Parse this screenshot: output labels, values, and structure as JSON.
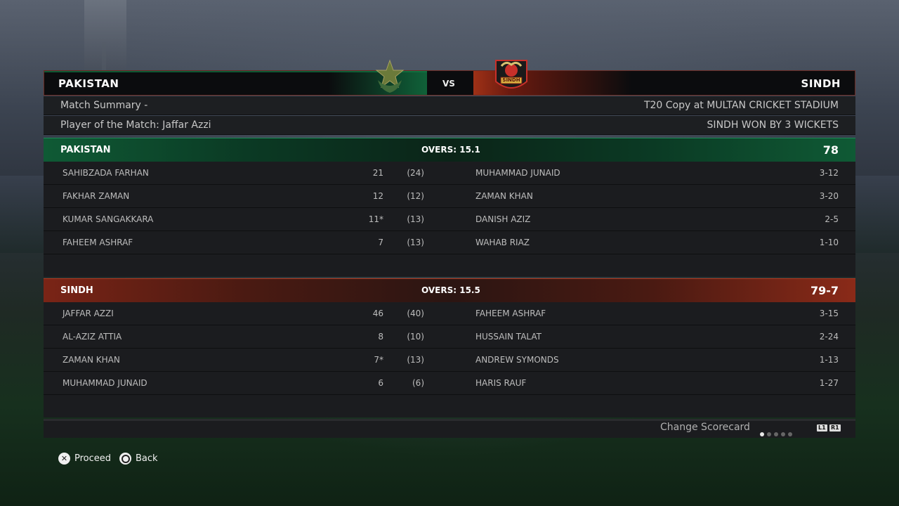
{
  "match": {
    "team_a": "PAKISTAN",
    "team_b": "SINDH",
    "vs": "VS",
    "summary_label": "Match Summary  -",
    "venue": "T20 Copy at MULTAN CRICKET STADIUM",
    "player_of_match": "Player of the Match: Jaffar Azzi",
    "result": "SINDH WON BY 3 WICKETS",
    "logo_b_text": "SINDH"
  },
  "innings": [
    {
      "team": "PAKISTAN",
      "overs": "OVERS: 15.1",
      "score": "78",
      "rows": [
        {
          "batter": "SAHIBZADA FARHAN",
          "runs": "21",
          "balls": "(24)",
          "bowler": "MUHAMMAD JUNAID",
          "figures": "3-12"
        },
        {
          "batter": "FAKHAR ZAMAN",
          "runs": "12",
          "balls": "(12)",
          "bowler": "ZAMAN KHAN",
          "figures": "3-20"
        },
        {
          "batter": "KUMAR SANGAKKARA",
          "runs": "11*",
          "balls": "(13)",
          "bowler": "DANISH AZIZ",
          "figures": "2-5"
        },
        {
          "batter": "FAHEEM ASHRAF",
          "runs": "7",
          "balls": "(13)",
          "bowler": "WAHAB RIAZ",
          "figures": "1-10"
        }
      ]
    },
    {
      "team": "SINDH",
      "overs": "OVERS: 15.5",
      "score": "79-7",
      "rows": [
        {
          "batter": "JAFFAR AZZI",
          "runs": "46",
          "balls": "(40)",
          "bowler": "FAHEEM ASHRAF",
          "figures": "3-15"
        },
        {
          "batter": "AL-AZIZ ATTIA",
          "runs": "8",
          "balls": "(10)",
          "bowler": "HUSSAIN TALAT",
          "figures": "2-24"
        },
        {
          "batter": "ZAMAN KHAN",
          "runs": "7*",
          "balls": "(13)",
          "bowler": "ANDREW SYMONDS",
          "figures": "1-13"
        },
        {
          "batter": "MUHAMMAD JUNAID",
          "runs": "6",
          "balls": "(6)",
          "bowler": "HARIS RAUF",
          "figures": "1-27"
        }
      ]
    }
  ],
  "footer": {
    "change_label": "Change Scorecard",
    "page_index": 1,
    "page_count": 5,
    "bumper_left": "L1",
    "bumper_right": "R1"
  },
  "buttons": {
    "proceed": "Proceed",
    "back": "Back"
  },
  "colors": {
    "team_a": "#0f5a35",
    "team_b": "#7a2416"
  },
  "icons": {
    "proceed": "cross-button-icon",
    "back": "circle-button-icon"
  }
}
